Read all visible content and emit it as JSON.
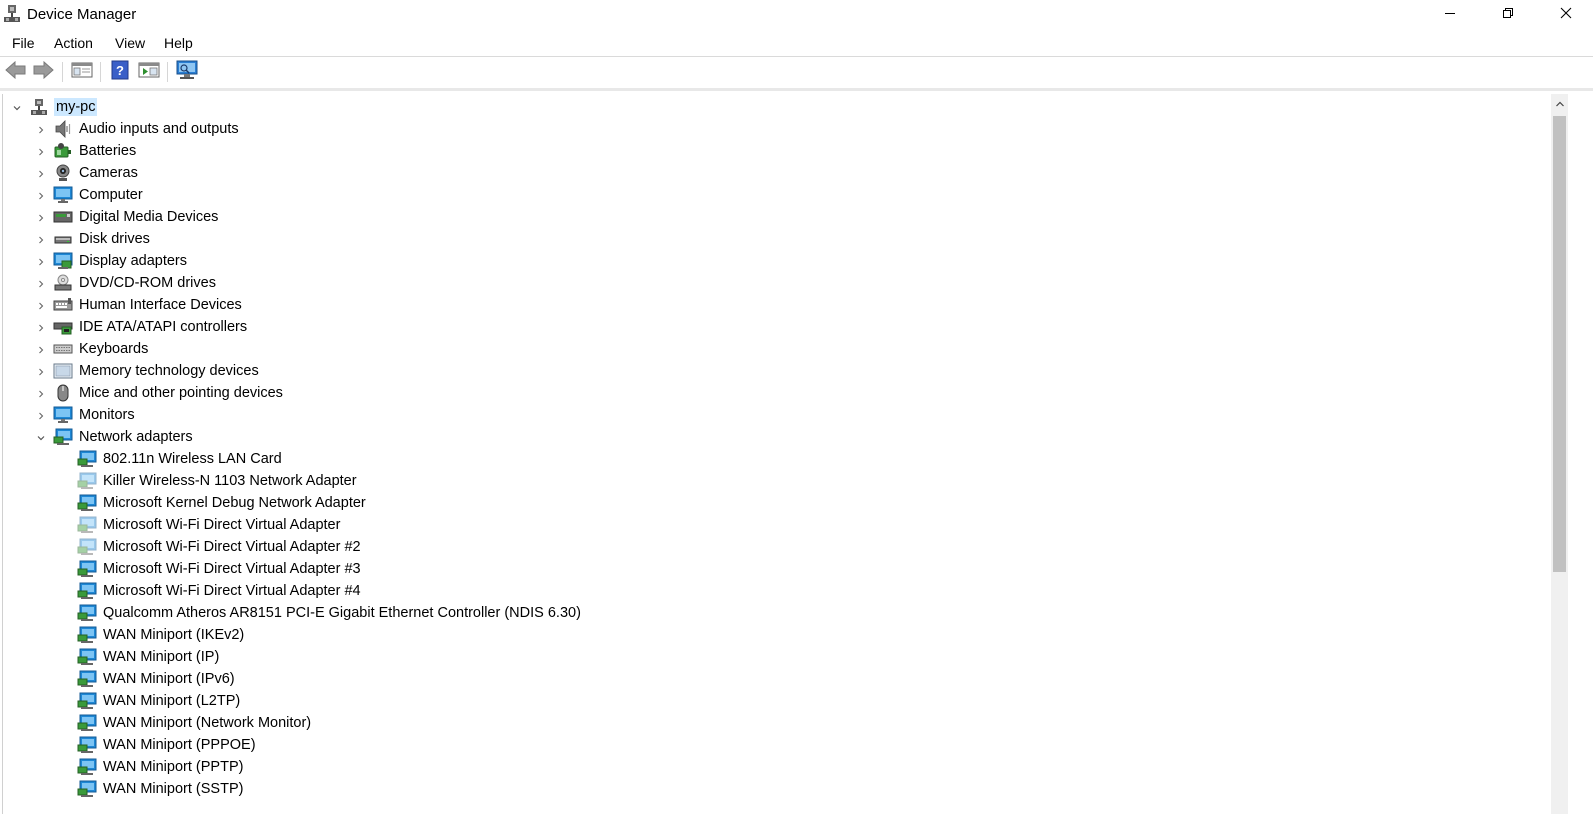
{
  "window": {
    "title": "Device Manager",
    "icon": "device-manager-icon"
  },
  "window_controls": {
    "minimize": "minimize-icon",
    "maximize": "restore-icon",
    "close": "close-icon"
  },
  "menu": [
    "File",
    "Action",
    "View",
    "Help"
  ],
  "toolbar": [
    "back-arrow-icon",
    "forward-arrow-icon",
    "show-hide-console-tree-icon",
    "help-icon",
    "show-action-pane-icon",
    "scan-hardware-icon"
  ],
  "tree": {
    "root": "my-pc",
    "categories": [
      {
        "label": "Audio inputs and outputs",
        "icon": "speaker-icon"
      },
      {
        "label": "Batteries",
        "icon": "battery-icon"
      },
      {
        "label": "Cameras",
        "icon": "webcam-icon"
      },
      {
        "label": "Computer",
        "icon": "computer-icon"
      },
      {
        "label": "Digital Media Devices",
        "icon": "media-device-icon"
      },
      {
        "label": "Disk drives",
        "icon": "disk-drive-icon"
      },
      {
        "label": "Display adapters",
        "icon": "display-adapter-icon"
      },
      {
        "label": "DVD/CD-ROM drives",
        "icon": "dvd-drive-icon"
      },
      {
        "label": "Human Interface Devices",
        "icon": "hid-icon"
      },
      {
        "label": "IDE ATA/ATAPI controllers",
        "icon": "ide-controller-icon"
      },
      {
        "label": "Keyboards",
        "icon": "keyboard-icon"
      },
      {
        "label": "Memory technology devices",
        "icon": "memory-device-icon"
      },
      {
        "label": "Mice and other pointing devices",
        "icon": "mouse-icon"
      },
      {
        "label": "Monitors",
        "icon": "monitor-icon"
      }
    ],
    "expanded": {
      "label": "Network adapters",
      "icon": "network-adapter-icon",
      "children": [
        {
          "label": "802.11n Wireless LAN Card",
          "disabled": false
        },
        {
          "label": "Killer Wireless-N 1103 Network Adapter",
          "disabled": true
        },
        {
          "label": "Microsoft Kernel Debug Network Adapter",
          "disabled": false
        },
        {
          "label": "Microsoft Wi-Fi Direct Virtual Adapter",
          "disabled": true
        },
        {
          "label": "Microsoft Wi-Fi Direct Virtual Adapter #2",
          "disabled": true
        },
        {
          "label": "Microsoft Wi-Fi Direct Virtual Adapter #3",
          "disabled": false
        },
        {
          "label": "Microsoft Wi-Fi Direct Virtual Adapter #4",
          "disabled": false
        },
        {
          "label": "Qualcomm Atheros AR8151 PCI-E Gigabit Ethernet Controller (NDIS 6.30)",
          "disabled": false
        },
        {
          "label": "WAN Miniport (IKEv2)",
          "disabled": false
        },
        {
          "label": "WAN Miniport (IP)",
          "disabled": false
        },
        {
          "label": "WAN Miniport (IPv6)",
          "disabled": false
        },
        {
          "label": "WAN Miniport (L2TP)",
          "disabled": false
        },
        {
          "label": "WAN Miniport (Network Monitor)",
          "disabled": false
        },
        {
          "label": "WAN Miniport (PPPOE)",
          "disabled": false
        },
        {
          "label": "WAN Miniport (PPTP)",
          "disabled": false
        },
        {
          "label": "WAN Miniport (SSTP)",
          "disabled": false
        }
      ]
    }
  },
  "colors": {
    "selection": "#cce8ff",
    "icon_blue": "#1e88d6",
    "icon_green": "#3a9a3a"
  }
}
